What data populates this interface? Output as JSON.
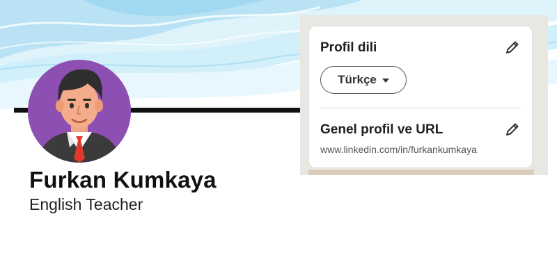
{
  "profile": {
    "name": "Furkan Kumkaya",
    "title": "English Teacher"
  },
  "settings_card": {
    "language_section": {
      "heading": "Profil dili",
      "selected_language": "Türkçe"
    },
    "url_section": {
      "heading": "Genel profil ve URL",
      "url": "www.linkedin.com/in/furkankumkaya"
    }
  },
  "colors": {
    "avatar_bg": "#8e4fb2",
    "banner_blue": "#bfe6f5",
    "text_dark": "#111111"
  },
  "icons": {
    "edit": "pencil-icon",
    "dropdown": "caret-down-icon"
  }
}
